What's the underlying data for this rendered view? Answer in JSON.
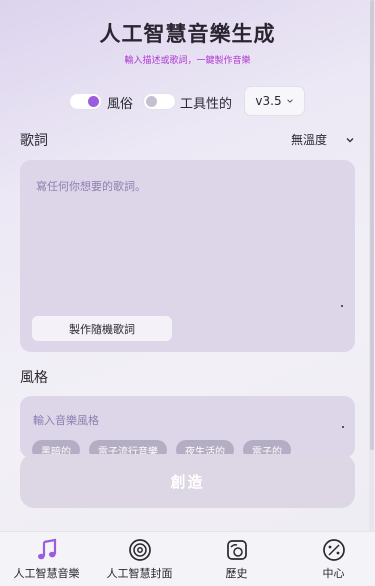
{
  "header": {
    "title": "人工智慧音樂生成",
    "subtitle": "輸入描述或歌詞，一鍵製作音樂"
  },
  "modes": {
    "style_toggle_label": "風俗",
    "style_toggle_on": true,
    "instrumental_toggle_label": "工具性的",
    "instrumental_toggle_on": false,
    "version": "v3.5"
  },
  "lyrics": {
    "label": "歌詞",
    "mood_selected": "無溫度",
    "placeholder": "寫任何你想要的歌詞。",
    "random_button": "製作隨機歌詞"
  },
  "style": {
    "label": "風格",
    "placeholder": "輸入音樂風格",
    "tags": [
      "黑暗的",
      "電子流行音樂",
      "夜生活的",
      "電子的"
    ]
  },
  "create_button": "創造",
  "nav": {
    "items": [
      {
        "label": "人工智慧音樂",
        "icon": "music-note-icon"
      },
      {
        "label": "人工智慧封面",
        "icon": "disc-icon"
      },
      {
        "label": "歷史",
        "icon": "history-icon"
      },
      {
        "label": "中心",
        "icon": "palette-icon"
      }
    ]
  },
  "colors": {
    "accent": "#9b5ce0",
    "subtitle": "#b03ad0"
  }
}
